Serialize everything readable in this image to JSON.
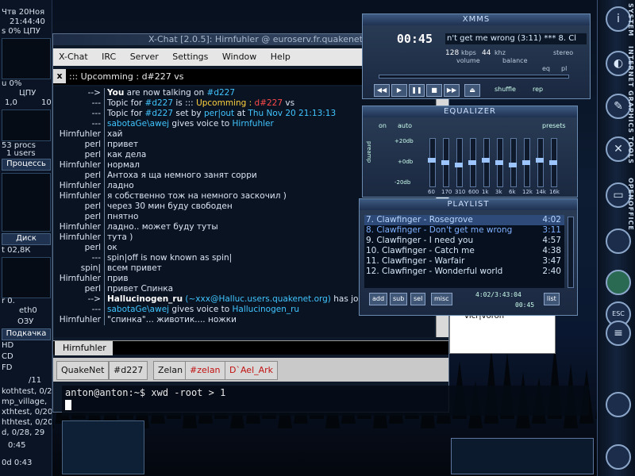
{
  "left_panel": {
    "date": "Чтв 20Ноя",
    "time": "21:44:40",
    "cpu_line": "s 0% ЦПУ",
    "cpu_pct": "u 0%",
    "cpu_label": "ЦПУ",
    "scale_a": "1,0",
    "scale_b": "10",
    "procs": "53 procs",
    "users": "1 users",
    "processes_btn": "Процессь",
    "disk_btn": "Диск",
    "disk_val": "t 02,8К",
    "r_val": "r 0.",
    "eth_label": "eth0",
    "ram_label": "ОЗУ",
    "swap_btn": "Подкачка",
    "hd": "HD",
    "cd": "CD",
    "fd": "FD",
    "load_val": "/11",
    "top_rows": [
      "kothtest, 0/2",
      "mp_village,",
      "xthtest, 0/20,",
      "hthtest, 0/20,",
      "d, 0/28, 29"
    ],
    "bottom_a": "0:45",
    "bottom_b": "0d  0:43"
  },
  "xchat": {
    "title": "X-Chat [2.0.5]: Hirnfuhler @ euroserv.fr.quakenet",
    "menu": [
      "X-Chat",
      "IRC",
      "Server",
      "Settings",
      "Window",
      "Help"
    ],
    "close_label": "x",
    "topic": "::: Upcomming : d#227 vs",
    "log": [
      {
        "nick": "-->",
        "parts": [
          {
            "t": "You",
            "c": "c-white"
          },
          {
            "t": " are now talking on "
          },
          {
            "t": "#d227",
            "c": "c-cyan"
          }
        ]
      },
      {
        "nick": "---",
        "parts": [
          {
            "t": "Topic for "
          },
          {
            "t": "#d227",
            "c": "c-cyan"
          },
          {
            "t": " is ::: "
          },
          {
            "t": "Upcomming : ",
            "c": "c-yel"
          },
          {
            "t": "d#227",
            "c": "c-red"
          },
          {
            "t": " vs"
          }
        ]
      },
      {
        "nick": "---",
        "parts": [
          {
            "t": "Topic for "
          },
          {
            "t": "#d227",
            "c": "c-cyan"
          },
          {
            "t": " set by "
          },
          {
            "t": "per|out",
            "c": "c-cyan"
          },
          {
            "t": " at "
          },
          {
            "t": "Thu Nov 20 21:13:13",
            "c": "c-cyan"
          }
        ]
      },
      {
        "nick": "---",
        "parts": [
          {
            "t": "sabotaGe\\awej",
            "c": "c-cyan"
          },
          {
            "t": " gives voice to "
          },
          {
            "t": "Hirnfuhler",
            "c": "c-cyan"
          }
        ]
      },
      {
        "nick": "Hirnfuhler",
        "parts": [
          {
            "t": "хай"
          }
        ]
      },
      {
        "nick": "perl",
        "parts": [
          {
            "t": "привет"
          }
        ]
      },
      {
        "nick": "perl",
        "parts": [
          {
            "t": "как дела"
          }
        ]
      },
      {
        "nick": "Hirnfuhler",
        "parts": [
          {
            "t": "нормал"
          }
        ]
      },
      {
        "nick": "perl",
        "parts": [
          {
            "t": "Антоха я ща немного занят сорри"
          }
        ]
      },
      {
        "nick": "Hirnfuhler",
        "parts": [
          {
            "t": "ладно"
          }
        ]
      },
      {
        "nick": "Hirnfuhler",
        "parts": [
          {
            "t": "я собственно тож на немного заскочил )"
          }
        ]
      },
      {
        "nick": "perl",
        "parts": [
          {
            "t": "через 30 мин буду свободен"
          }
        ]
      },
      {
        "nick": "perl",
        "parts": [
          {
            "t": "пнятно"
          }
        ]
      },
      {
        "nick": "Hirnfuhler",
        "parts": [
          {
            "t": "ладно.. может буду туты"
          }
        ]
      },
      {
        "nick": "Hirnfuhler",
        "parts": [
          {
            "t": "тута )"
          }
        ]
      },
      {
        "nick": "perl",
        "parts": [
          {
            "t": "ок"
          }
        ]
      },
      {
        "nick": "---",
        "parts": [
          {
            "t": "spin|off is now known as spin|"
          }
        ]
      },
      {
        "nick": "spin|",
        "parts": [
          {
            "t": "всем привет"
          }
        ]
      },
      {
        "nick": "Hirnfuhler",
        "parts": [
          {
            "t": "прив"
          }
        ]
      },
      {
        "nick": "perl",
        "parts": [
          {
            "t": "привет Спинка"
          }
        ]
      },
      {
        "nick": "-->",
        "parts": [
          {
            "t": "Hallucinogen_ru",
            "c": "c-white"
          },
          {
            "t": " (~xxx@Halluc.users.quakenet.org)",
            "c": "c-cyan"
          },
          {
            "t": " has joined #d"
          }
        ]
      },
      {
        "nick": "---",
        "parts": [
          {
            "t": "sabotaGe\\awej",
            "c": "c-cyan"
          },
          {
            "t": " gives voice to "
          },
          {
            "t": "Hallucinogen_ru",
            "c": "c-cyan"
          }
        ]
      },
      {
        "nick": "Hirnfuhler",
        "parts": [
          {
            "t": "\"спинка\"... животик.... ножки"
          }
        ]
      }
    ],
    "input_nick": "Hirnfuhler",
    "tabs": [
      {
        "label": "QuakeNet",
        "red": false
      },
      {
        "label": "#d227",
        "red": false
      },
      {
        "label": "Zelan",
        "red": false
      },
      {
        "label": "#zelan",
        "red": true
      },
      {
        "label": "D`Ael_Ark",
        "red": true
      }
    ],
    "userlist_tail": "vicr|voron"
  },
  "terminal": {
    "line": "anton@anton:~$ xwd -root > 1"
  },
  "xmms": {
    "title": "XMMS",
    "time": "00:45",
    "song": "n't get me wrong (3:11) *** 8. Cl",
    "kbps": "128",
    "kbps_label": "kbps",
    "khz": "44",
    "khz_label": "khz",
    "stereo": "stereo",
    "volume_label": "volume",
    "balance_label": "balance",
    "eq_btn": "eq",
    "pl_btn": "pl",
    "shuffle": "shuffle",
    "rep": "rep",
    "controls": [
      "◀◀",
      "▶",
      "❚❚",
      "■",
      "▶▶",
      "⏏"
    ]
  },
  "equalizer": {
    "title": "EQUALIZER",
    "on": "on",
    "auto": "auto",
    "presets": "presets",
    "preamp": "preamp",
    "db_top": "+20db",
    "db_mid": "+0db",
    "db_bot": "-20db",
    "bands": [
      "60",
      "170",
      "310",
      "600",
      "1k",
      "3k",
      "6k",
      "12k",
      "14k",
      "16k"
    ],
    "levels": [
      0.55,
      0.5,
      0.45,
      0.5,
      0.55,
      0.5,
      0.45,
      0.5,
      0.55,
      0.5
    ]
  },
  "playlist": {
    "title": "PLAYLIST",
    "items": [
      {
        "label": "7. Clawfinger - Rosegrove",
        "dur": "4:02",
        "sel": true
      },
      {
        "label": "8. Clawfinger - Don't get me wrong",
        "dur": "3:11",
        "sel": false,
        "current": true
      },
      {
        "label": "9. Clawfinger - I need you",
        "dur": "4:57",
        "sel": false
      },
      {
        "label": "10. Clawfinger - Catch me",
        "dur": "4:38",
        "sel": false
      },
      {
        "label": "11. Clawfinger - Warfair",
        "dur": "3:47",
        "sel": false
      },
      {
        "label": "12. Clawfinger - Wonderful world",
        "dur": "2:40",
        "sel": false
      }
    ],
    "buttons": [
      "add",
      "sub",
      "sel",
      "misc"
    ],
    "list_btn": "list",
    "total": "4:02/3:43:04",
    "mini_time": "00:45"
  },
  "dock": {
    "labels": [
      "SYSTEM",
      "INTERNET",
      "GRAPHICS",
      "TOOLS",
      "OPENOFFICE"
    ],
    "esc": "ESC"
  }
}
